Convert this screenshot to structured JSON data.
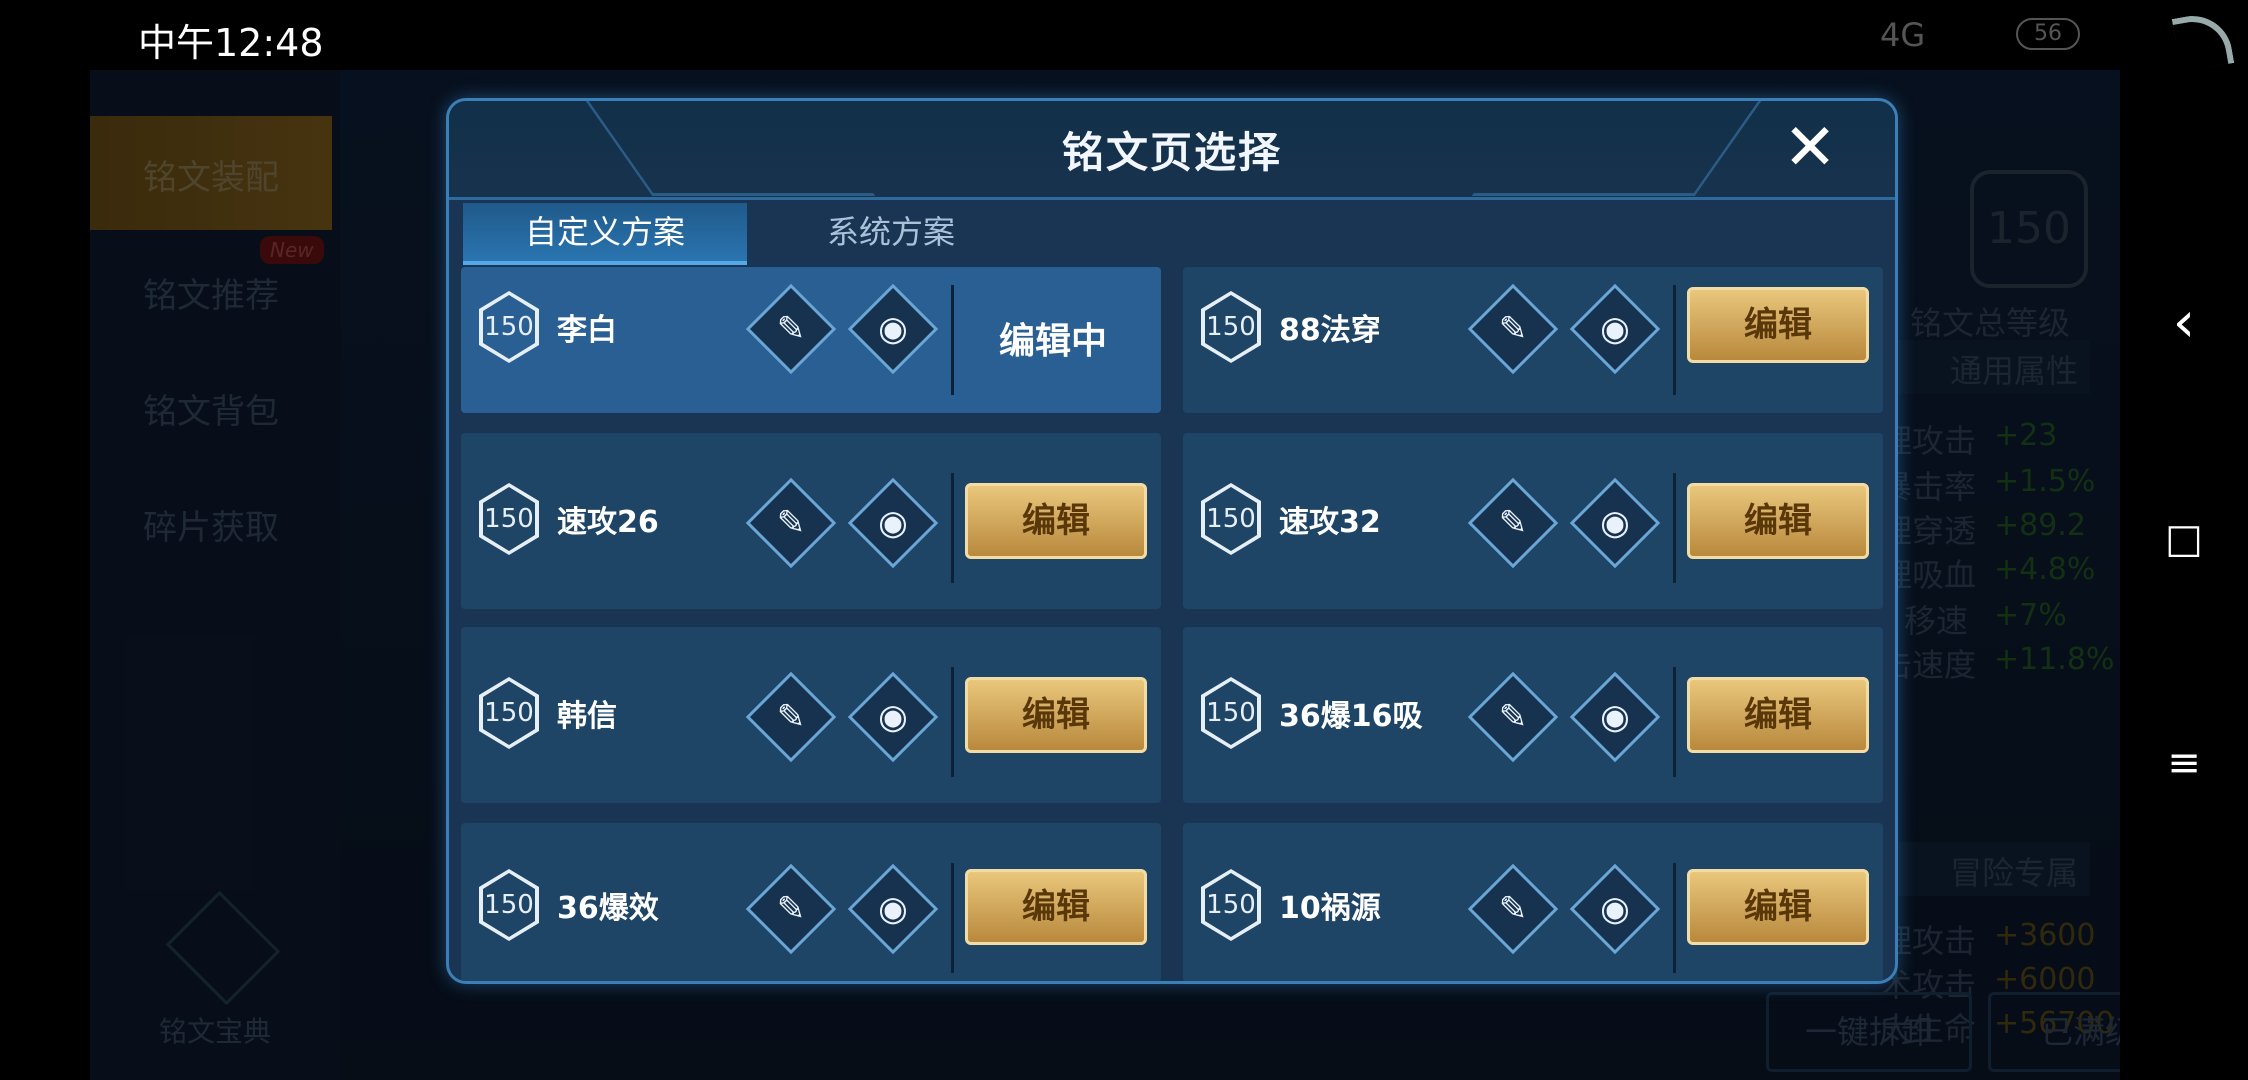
{
  "status_bar": {
    "time": "中午12:48",
    "network": "4G",
    "battery": "56"
  },
  "background": {
    "left_menu": [
      "铭文装配",
      "铭文推荐",
      "铭文背包",
      "碎片获取"
    ],
    "new_tag": "New",
    "book_label": "铭文宝典",
    "level": "150",
    "level_label": "铭文总等级",
    "common_attr_title": "通用属性",
    "attrs": [
      {
        "name": "理攻击",
        "value": "+23"
      },
      {
        "name": "暴击率",
        "value": "+1.5%"
      },
      {
        "name": "理穿透",
        "value": "+89.2"
      },
      {
        "name": "理吸血",
        "value": "+4.8%"
      },
      {
        "name": "移速",
        "value": "+7%"
      },
      {
        "name": "击速度",
        "value": "+11.8%"
      }
    ],
    "adventure_title": "冒险专属",
    "adventure_attrs": [
      {
        "name": "理攻击",
        "value": "+3600"
      },
      {
        "name": "术攻击",
        "value": "+6000"
      },
      {
        "name": "大生命",
        "value": "+56700"
      }
    ],
    "btn_unload": "一键拆卸",
    "btn_maxed": "已满级"
  },
  "modal": {
    "title": "铭文页选择",
    "close": "✕",
    "tabs": [
      "自定义方案",
      "系统方案"
    ],
    "edit_label": "编辑",
    "editing_label": "编辑中",
    "pages": [
      {
        "level": "150",
        "name": "李白"
      },
      {
        "level": "150",
        "name": "88法穿"
      },
      {
        "level": "150",
        "name": "速攻26"
      },
      {
        "level": "150",
        "name": "速攻32"
      },
      {
        "level": "150",
        "name": "韩信"
      },
      {
        "level": "150",
        "name": "36爆16吸"
      },
      {
        "level": "150",
        "name": "36爆效"
      },
      {
        "level": "150",
        "name": "10祸源"
      }
    ]
  },
  "nav": {
    "back": "‹",
    "home": "□",
    "menu": "≡"
  }
}
